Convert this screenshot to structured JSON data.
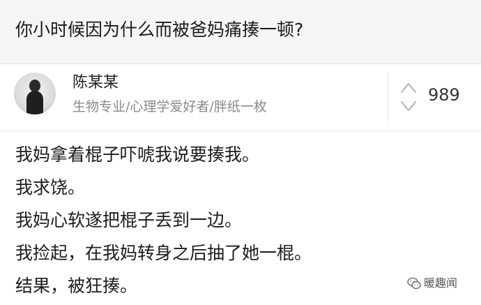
{
  "question": {
    "title": "你小时候因为什么而被爸妈痛揍一顿?"
  },
  "answer": {
    "author": {
      "name": "陈某某",
      "bio": "生物专业/心理学爱好者/胖纸一枚"
    },
    "votes": "989",
    "lines": [
      "我妈拿着棍子吓唬我说要揍我。",
      "我求饶。",
      "我妈心软遂把棍子丢到一边。",
      "我捡起，在我妈转身之后抽了她一棍。",
      "结果，被狂揍。"
    ]
  },
  "watermark": {
    "text": "暖趣闻",
    "icon": "wechat-icon"
  },
  "colors": {
    "question_bg": "#f5f5f8",
    "bio_text": "#8a8a8a",
    "vote_arrow": "#b9b9c2"
  }
}
